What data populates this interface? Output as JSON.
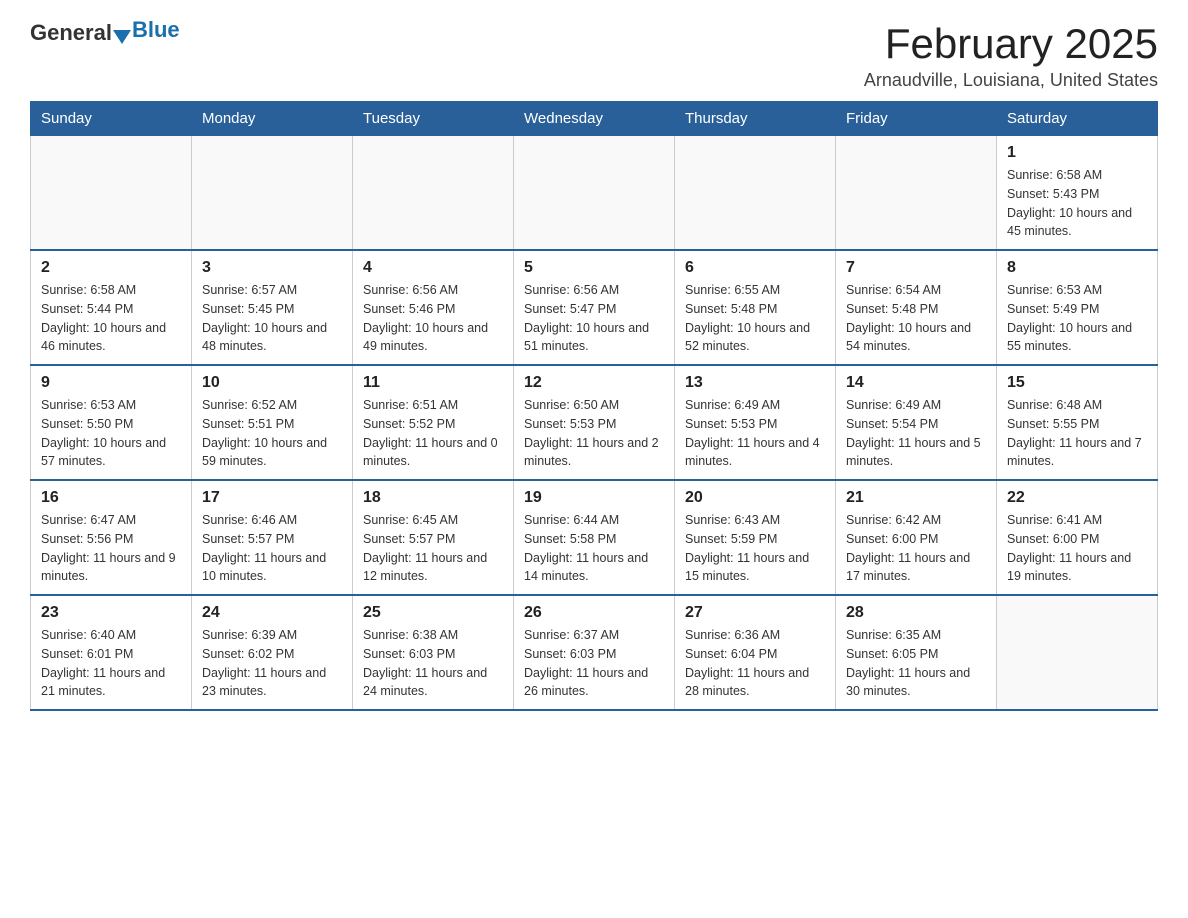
{
  "logo": {
    "general": "General",
    "blue": "Blue"
  },
  "title": "February 2025",
  "location": "Arnaudville, Louisiana, United States",
  "days_of_week": [
    "Sunday",
    "Monday",
    "Tuesday",
    "Wednesday",
    "Thursday",
    "Friday",
    "Saturday"
  ],
  "weeks": [
    [
      {
        "day": "",
        "info": ""
      },
      {
        "day": "",
        "info": ""
      },
      {
        "day": "",
        "info": ""
      },
      {
        "day": "",
        "info": ""
      },
      {
        "day": "",
        "info": ""
      },
      {
        "day": "",
        "info": ""
      },
      {
        "day": "1",
        "info": "Sunrise: 6:58 AM\nSunset: 5:43 PM\nDaylight: 10 hours and 45 minutes."
      }
    ],
    [
      {
        "day": "2",
        "info": "Sunrise: 6:58 AM\nSunset: 5:44 PM\nDaylight: 10 hours and 46 minutes."
      },
      {
        "day": "3",
        "info": "Sunrise: 6:57 AM\nSunset: 5:45 PM\nDaylight: 10 hours and 48 minutes."
      },
      {
        "day": "4",
        "info": "Sunrise: 6:56 AM\nSunset: 5:46 PM\nDaylight: 10 hours and 49 minutes."
      },
      {
        "day": "5",
        "info": "Sunrise: 6:56 AM\nSunset: 5:47 PM\nDaylight: 10 hours and 51 minutes."
      },
      {
        "day": "6",
        "info": "Sunrise: 6:55 AM\nSunset: 5:48 PM\nDaylight: 10 hours and 52 minutes."
      },
      {
        "day": "7",
        "info": "Sunrise: 6:54 AM\nSunset: 5:48 PM\nDaylight: 10 hours and 54 minutes."
      },
      {
        "day": "8",
        "info": "Sunrise: 6:53 AM\nSunset: 5:49 PM\nDaylight: 10 hours and 55 minutes."
      }
    ],
    [
      {
        "day": "9",
        "info": "Sunrise: 6:53 AM\nSunset: 5:50 PM\nDaylight: 10 hours and 57 minutes."
      },
      {
        "day": "10",
        "info": "Sunrise: 6:52 AM\nSunset: 5:51 PM\nDaylight: 10 hours and 59 minutes."
      },
      {
        "day": "11",
        "info": "Sunrise: 6:51 AM\nSunset: 5:52 PM\nDaylight: 11 hours and 0 minutes."
      },
      {
        "day": "12",
        "info": "Sunrise: 6:50 AM\nSunset: 5:53 PM\nDaylight: 11 hours and 2 minutes."
      },
      {
        "day": "13",
        "info": "Sunrise: 6:49 AM\nSunset: 5:53 PM\nDaylight: 11 hours and 4 minutes."
      },
      {
        "day": "14",
        "info": "Sunrise: 6:49 AM\nSunset: 5:54 PM\nDaylight: 11 hours and 5 minutes."
      },
      {
        "day": "15",
        "info": "Sunrise: 6:48 AM\nSunset: 5:55 PM\nDaylight: 11 hours and 7 minutes."
      }
    ],
    [
      {
        "day": "16",
        "info": "Sunrise: 6:47 AM\nSunset: 5:56 PM\nDaylight: 11 hours and 9 minutes."
      },
      {
        "day": "17",
        "info": "Sunrise: 6:46 AM\nSunset: 5:57 PM\nDaylight: 11 hours and 10 minutes."
      },
      {
        "day": "18",
        "info": "Sunrise: 6:45 AM\nSunset: 5:57 PM\nDaylight: 11 hours and 12 minutes."
      },
      {
        "day": "19",
        "info": "Sunrise: 6:44 AM\nSunset: 5:58 PM\nDaylight: 11 hours and 14 minutes."
      },
      {
        "day": "20",
        "info": "Sunrise: 6:43 AM\nSunset: 5:59 PM\nDaylight: 11 hours and 15 minutes."
      },
      {
        "day": "21",
        "info": "Sunrise: 6:42 AM\nSunset: 6:00 PM\nDaylight: 11 hours and 17 minutes."
      },
      {
        "day": "22",
        "info": "Sunrise: 6:41 AM\nSunset: 6:00 PM\nDaylight: 11 hours and 19 minutes."
      }
    ],
    [
      {
        "day": "23",
        "info": "Sunrise: 6:40 AM\nSunset: 6:01 PM\nDaylight: 11 hours and 21 minutes."
      },
      {
        "day": "24",
        "info": "Sunrise: 6:39 AM\nSunset: 6:02 PM\nDaylight: 11 hours and 23 minutes."
      },
      {
        "day": "25",
        "info": "Sunrise: 6:38 AM\nSunset: 6:03 PM\nDaylight: 11 hours and 24 minutes."
      },
      {
        "day": "26",
        "info": "Sunrise: 6:37 AM\nSunset: 6:03 PM\nDaylight: 11 hours and 26 minutes."
      },
      {
        "day": "27",
        "info": "Sunrise: 6:36 AM\nSunset: 6:04 PM\nDaylight: 11 hours and 28 minutes."
      },
      {
        "day": "28",
        "info": "Sunrise: 6:35 AM\nSunset: 6:05 PM\nDaylight: 11 hours and 30 minutes."
      },
      {
        "day": "",
        "info": ""
      }
    ]
  ]
}
